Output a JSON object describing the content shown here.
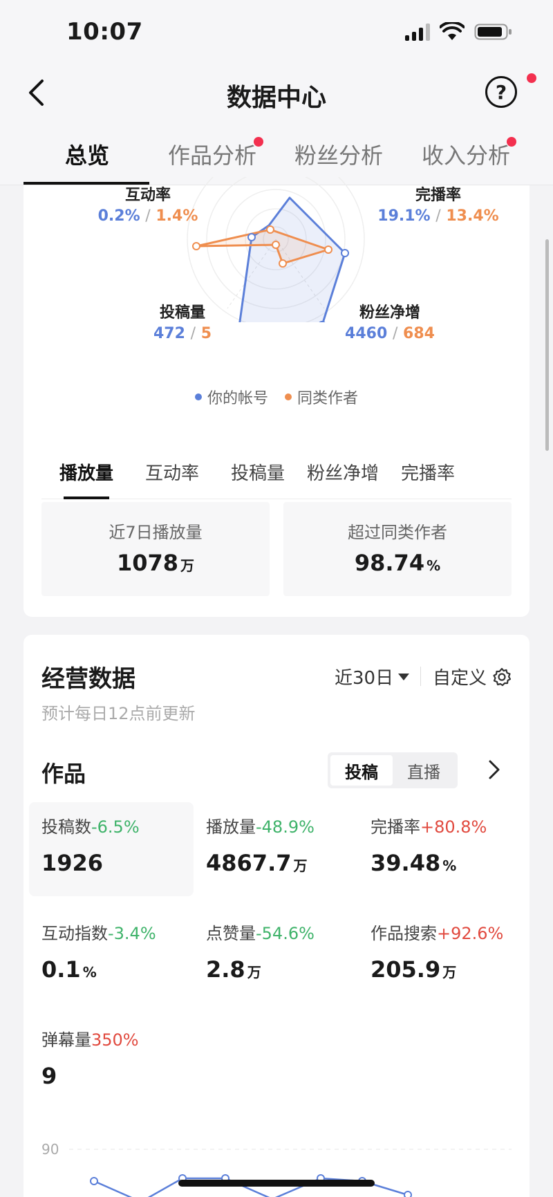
{
  "status": {
    "time": "10:07"
  },
  "nav": {
    "title": "数据中心",
    "help": "?"
  },
  "tabs": [
    {
      "label": "总览",
      "active": true,
      "dot": false
    },
    {
      "label": "作品分析",
      "active": false,
      "dot": true
    },
    {
      "label": "粉丝分析",
      "active": false,
      "dot": false
    },
    {
      "label": "收入分析",
      "active": false,
      "dot": true
    }
  ],
  "radar": {
    "axes": [
      {
        "name": "互动率",
        "mine": "0.2%",
        "peer": "1.4%"
      },
      {
        "name": "完播率",
        "mine": "19.1%",
        "peer": "13.4%"
      },
      {
        "name": "投稿量",
        "mine": "472",
        "peer": "5"
      },
      {
        "name": "粉丝净增",
        "mine": "4460",
        "peer": "684"
      }
    ],
    "separator": "/",
    "legend": {
      "mine": "你的帐号",
      "peer": "同类作者"
    },
    "colors": {
      "mine": "#5b7fd9",
      "peer": "#ef8e4f"
    }
  },
  "subtabs": [
    "播放量",
    "互动率",
    "投稿量",
    "粉丝净增",
    "完播率"
  ],
  "summary": {
    "left": {
      "label": "近7日播放量",
      "value": "1078",
      "unit": "万"
    },
    "right": {
      "label": "超过同类作者",
      "value": "98.74",
      "unit": "%"
    }
  },
  "business": {
    "title": "经营数据",
    "subtitle": "预计每日12点前更新",
    "range": "近30日",
    "custom": "自定义"
  },
  "works": {
    "title": "作品",
    "segments": [
      "投稿",
      "直播"
    ],
    "metrics": [
      {
        "label": "投稿数",
        "delta": "-6.5%",
        "trend": "down",
        "value": "1926",
        "unit": ""
      },
      {
        "label": "播放量",
        "delta": "-48.9%",
        "trend": "down",
        "value": "4867.7",
        "unit": "万"
      },
      {
        "label": "完播率",
        "delta": "+80.8%",
        "trend": "up",
        "value": "39.48",
        "unit": "%"
      },
      {
        "label": "互动指数",
        "delta": "-3.4%",
        "trend": "down",
        "value": "0.1",
        "unit": "%"
      },
      {
        "label": "点赞量",
        "delta": "-54.6%",
        "trend": "down",
        "value": "2.8",
        "unit": "万"
      },
      {
        "label": "作品搜索",
        "delta": "+92.6%",
        "trend": "up",
        "value": "205.9",
        "unit": "万"
      },
      {
        "label": "弹幕量",
        "delta": "350%",
        "trend": "up",
        "value": "9",
        "unit": ""
      }
    ]
  },
  "chart": {
    "y_tick": "90"
  }
}
